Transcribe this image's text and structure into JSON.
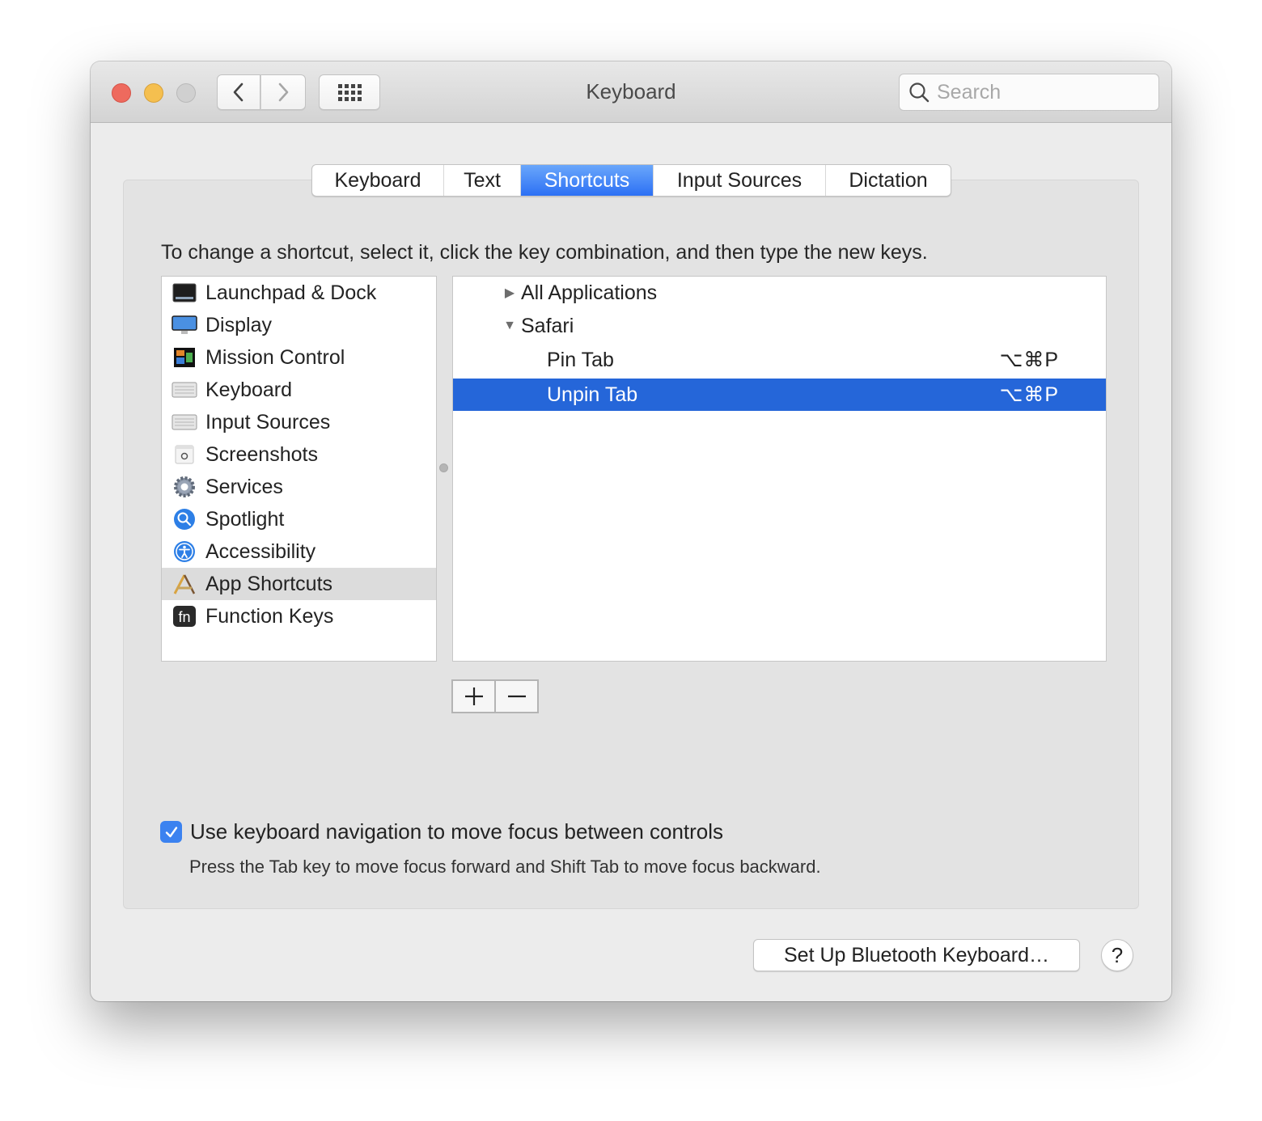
{
  "window": {
    "title": "Keyboard",
    "search_placeholder": "Search"
  },
  "tabs": [
    {
      "label": "Keyboard",
      "active": false
    },
    {
      "label": "Text",
      "active": false
    },
    {
      "label": "Shortcuts",
      "active": true
    },
    {
      "label": "Input Sources",
      "active": false
    },
    {
      "label": "Dictation",
      "active": false
    }
  ],
  "instructions": "To change a shortcut, select it, click the key combination, and then type the new keys.",
  "categories": [
    {
      "label": "Launchpad & Dock",
      "icon": "launchpad-dock-icon"
    },
    {
      "label": "Display",
      "icon": "display-icon"
    },
    {
      "label": "Mission Control",
      "icon": "mission-control-icon"
    },
    {
      "label": "Keyboard",
      "icon": "keyboard-icon"
    },
    {
      "label": "Input Sources",
      "icon": "input-sources-icon"
    },
    {
      "label": "Screenshots",
      "icon": "screenshots-icon"
    },
    {
      "label": "Services",
      "icon": "services-gear-icon"
    },
    {
      "label": "Spotlight",
      "icon": "spotlight-icon"
    },
    {
      "label": "Accessibility",
      "icon": "accessibility-icon"
    },
    {
      "label": "App Shortcuts",
      "icon": "app-shortcuts-icon",
      "selected": true
    },
    {
      "label": "Function Keys",
      "icon": "fn-key-icon"
    }
  ],
  "shortcuts": [
    {
      "label": "All Applications",
      "disclosure": "▶",
      "expanded": false,
      "keys": ""
    },
    {
      "label": "Safari",
      "disclosure": "▼",
      "expanded": true,
      "keys": ""
    },
    {
      "label": "Pin Tab",
      "keys": "⌥⌘P"
    },
    {
      "label": "Unpin Tab",
      "keys": "⌥⌘P",
      "selected": true
    }
  ],
  "buttons": {
    "add": "+",
    "remove": "−",
    "bluetooth": "Set Up Bluetooth Keyboard…",
    "help": "?"
  },
  "keyboard_navigation": {
    "checked": true,
    "label": "Use keyboard navigation to move focus between controls",
    "hint": "Press the Tab key to move focus forward and Shift Tab to move focus backward."
  },
  "colors": {
    "accent": "#2c70f4",
    "selection": "#2566d9",
    "checkbox": "#3b82f0"
  }
}
